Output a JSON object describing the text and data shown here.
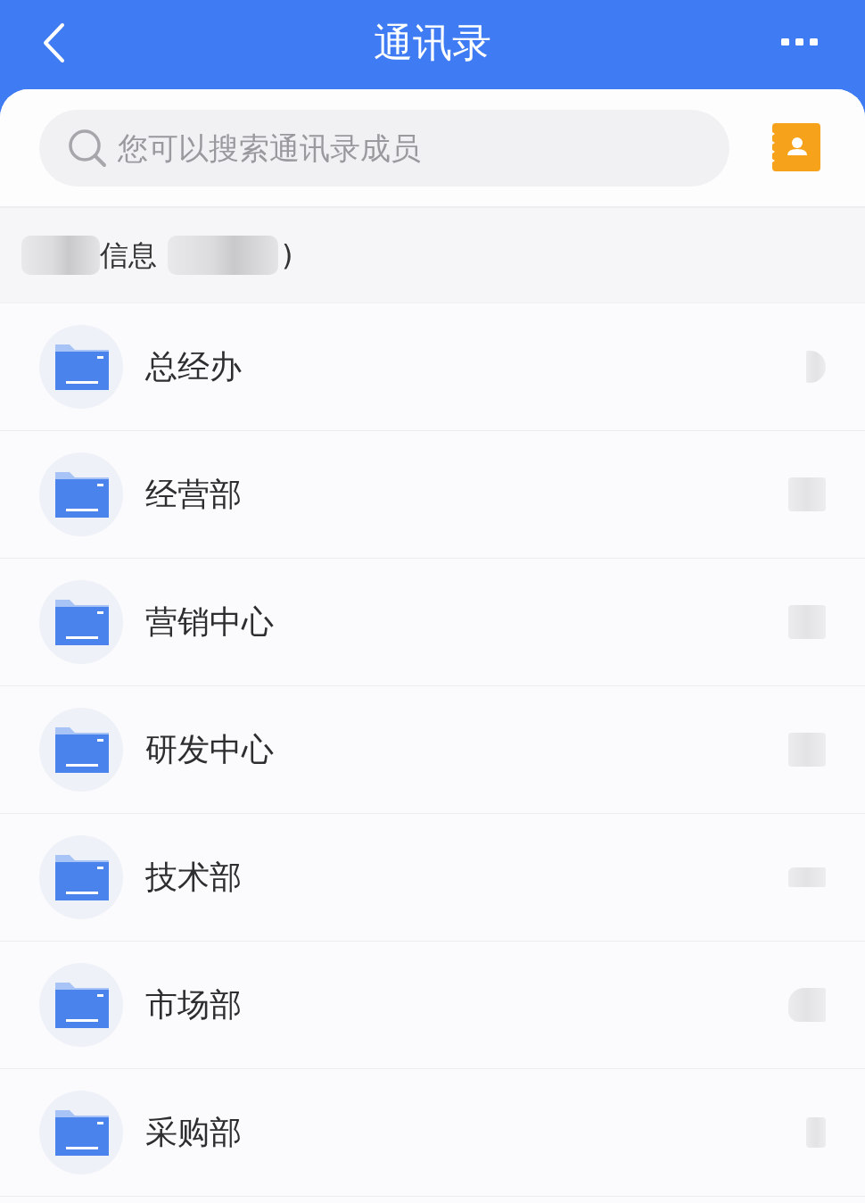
{
  "header": {
    "title": "通讯录"
  },
  "search": {
    "placeholder": "您可以搜索通讯录成员"
  },
  "info_bar": {
    "label": "信息",
    "closing": ")"
  },
  "departments": [
    {
      "name": "总经办"
    },
    {
      "name": "经营部"
    },
    {
      "name": "营销中心"
    },
    {
      "name": "研发中心"
    },
    {
      "name": "技术部"
    },
    {
      "name": "市场部"
    },
    {
      "name": "采购部"
    }
  ]
}
